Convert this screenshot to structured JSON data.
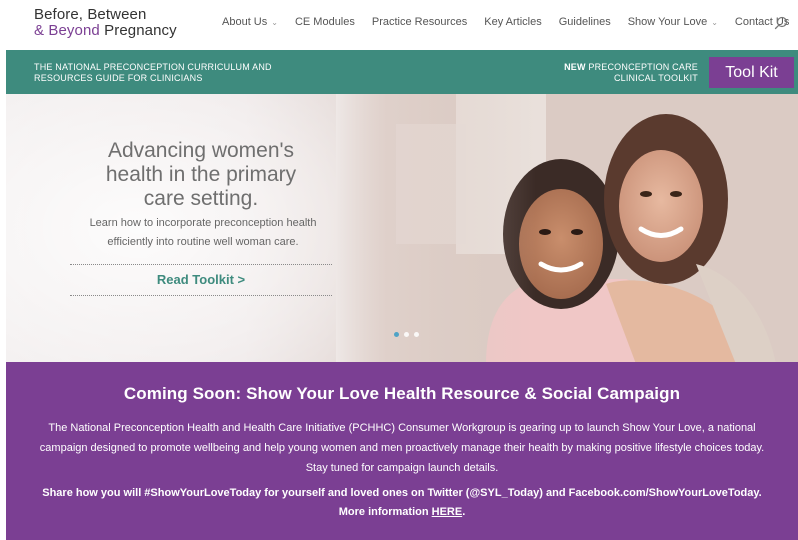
{
  "logo": {
    "line1": "Before, Between",
    "amp": "& ",
    "beyond": "Beyond",
    "pregnancy": " Pregnancy"
  },
  "nav": {
    "items": [
      {
        "label": "About Us",
        "caret": "⌄"
      },
      {
        "label": "CE Modules"
      },
      {
        "label": "Practice Resources"
      },
      {
        "label": "Key Articles"
      },
      {
        "label": "Guidelines"
      },
      {
        "label": "Show Your Love",
        "caret": "⌄"
      },
      {
        "label": "Contact Us"
      }
    ],
    "search_icon": "search-icon"
  },
  "banner": {
    "left_line1": "THE NATIONAL PRECONCEPTION CURRICULUM AND",
    "left_line2": "RESOURCES GUIDE FOR CLINICIANS",
    "right_new": "NEW",
    "right_line1_rest": " PRECONCEPTION CARE",
    "right_line2": "CLINICAL TOOLKIT",
    "button_label": "Tool Kit",
    "bg_color": "#3e8b7e",
    "button_color": "#7b3f93"
  },
  "hero": {
    "heading_line1": "Advancing women's",
    "heading_line2": "health in the primary",
    "heading_line3": "care setting.",
    "sub_line1": "Learn how to incorporate preconception health",
    "sub_line2": "efficiently into routine well woman care.",
    "cta": "Read Toolkit >",
    "slide_count": 3,
    "active_slide": 1
  },
  "campaign": {
    "title": "Coming Soon: Show Your Love Health Resource & Social Campaign",
    "body": "The National Preconception Health and Health Care Initiative (PCHHC) Consumer Workgroup is gearing up to launch Show Your Love, a national campaign designed to promote wellbeing and help young women and men proactively manage their health by making positive lifestyle choices today. Stay tuned for campaign launch details.",
    "share_line1": "Share how you will #ShowYourLoveToday for yourself and loved ones on Twitter (@SYL_Today) and Facebook.com/ShowYourLoveToday.",
    "more_info": "More information ",
    "link": "HERE",
    "period": ".",
    "bg_color": "#7b3f93"
  }
}
